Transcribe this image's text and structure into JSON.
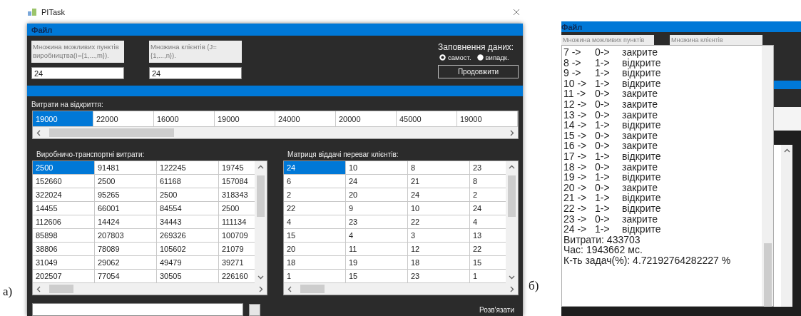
{
  "panel_a": {
    "caption": "а)",
    "title": "PITask",
    "menu": [
      "Файл"
    ],
    "fields": [
      {
        "label": "Множина можливих пунктів виробництва(I={1,...,m}).",
        "value": "24"
      },
      {
        "label": "Множина клієнтів (J={1,...,n}).",
        "value": "24"
      }
    ],
    "fill_options": {
      "title": "Заповнення даних:",
      "options": [
        {
          "label": "самост.",
          "selected": true
        },
        {
          "label": "випадк.",
          "selected": false
        }
      ]
    },
    "continue_button": "Продовжити",
    "opening_costs": {
      "title": "Витрати на відкриття:",
      "cells": [
        {
          "text": "19000",
          "selected": true
        },
        {
          "text": "22000",
          "selected": false
        },
        {
          "text": "16000",
          "selected": false
        },
        {
          "text": "19000",
          "selected": false
        },
        {
          "text": "24000",
          "selected": false
        },
        {
          "text": "20000",
          "selected": false
        },
        {
          "text": "45000",
          "selected": false
        },
        {
          "text": "19000",
          "selected": false
        }
      ]
    },
    "transport_costs": {
      "title": "Виробничо-транспортні витрати:",
      "rows": [
        [
          {
            "text": "2500",
            "selected": true
          },
          {
            "text": "91481",
            "selected": false
          },
          {
            "text": "122245",
            "selected": false
          },
          {
            "text": "19745",
            "selected": false
          }
        ],
        [
          {
            "text": "152660",
            "selected": false
          },
          {
            "text": "2500",
            "selected": false
          },
          {
            "text": "61168",
            "selected": false
          },
          {
            "text": "157084",
            "selected": false
          }
        ],
        [
          {
            "text": "322024",
            "selected": false
          },
          {
            "text": "95265",
            "selected": false
          },
          {
            "text": "2500",
            "selected": false
          },
          {
            "text": "318343",
            "selected": false
          }
        ],
        [
          {
            "text": "14455",
            "selected": false
          },
          {
            "text": "66001",
            "selected": false
          },
          {
            "text": "84554",
            "selected": false
          },
          {
            "text": "2500",
            "selected": false
          }
        ],
        [
          {
            "text": "112606",
            "selected": false
          },
          {
            "text": "14424",
            "selected": false
          },
          {
            "text": "34443",
            "selected": false
          },
          {
            "text": "111134",
            "selected": false
          }
        ],
        [
          {
            "text": "85898",
            "selected": false
          },
          {
            "text": "207803",
            "selected": false
          },
          {
            "text": "269326",
            "selected": false
          },
          {
            "text": "100709",
            "selected": false
          }
        ],
        [
          {
            "text": "38806",
            "selected": false
          },
          {
            "text": "78089",
            "selected": false
          },
          {
            "text": "105602",
            "selected": false
          },
          {
            "text": "21079",
            "selected": false
          }
        ],
        [
          {
            "text": "31049",
            "selected": false
          },
          {
            "text": "29062",
            "selected": false
          },
          {
            "text": "49479",
            "selected": false
          },
          {
            "text": "39271",
            "selected": false
          }
        ],
        [
          {
            "text": "202507",
            "selected": false
          },
          {
            "text": "77054",
            "selected": false
          },
          {
            "text": "30505",
            "selected": false
          },
          {
            "text": "226160",
            "selected": false
          }
        ]
      ]
    },
    "preferences": {
      "title": "Матриця віддачі переваг клієнтів:",
      "rows": [
        [
          {
            "text": "24",
            "selected": true
          },
          {
            "text": "10",
            "selected": false
          },
          {
            "text": "8",
            "selected": false
          },
          {
            "text": "23",
            "selected": false
          }
        ],
        [
          {
            "text": "6",
            "selected": false
          },
          {
            "text": "24",
            "selected": false
          },
          {
            "text": "21",
            "selected": false
          },
          {
            "text": "8",
            "selected": false
          }
        ],
        [
          {
            "text": "2",
            "selected": false
          },
          {
            "text": "20",
            "selected": false
          },
          {
            "text": "24",
            "selected": false
          },
          {
            "text": "2",
            "selected": false
          }
        ],
        [
          {
            "text": "22",
            "selected": false
          },
          {
            "text": "9",
            "selected": false
          },
          {
            "text": "10",
            "selected": false
          },
          {
            "text": "24",
            "selected": false
          }
        ],
        [
          {
            "text": "4",
            "selected": false
          },
          {
            "text": "23",
            "selected": false
          },
          {
            "text": "22",
            "selected": false
          },
          {
            "text": "4",
            "selected": false
          }
        ],
        [
          {
            "text": "15",
            "selected": false
          },
          {
            "text": "4",
            "selected": false
          },
          {
            "text": "3",
            "selected": false
          },
          {
            "text": "13",
            "selected": false
          }
        ],
        [
          {
            "text": "20",
            "selected": false
          },
          {
            "text": "11",
            "selected": false
          },
          {
            "text": "12",
            "selected": false
          },
          {
            "text": "22",
            "selected": false
          }
        ],
        [
          {
            "text": "18",
            "selected": false
          },
          {
            "text": "19",
            "selected": false
          },
          {
            "text": "18",
            "selected": false
          },
          {
            "text": "15",
            "selected": false
          }
        ],
        [
          {
            "text": "1",
            "selected": false
          },
          {
            "text": "15",
            "selected": false
          },
          {
            "text": "23",
            "selected": false
          },
          {
            "text": "1",
            "selected": false
          }
        ]
      ]
    },
    "solve_button": "Розв'язати"
  },
  "panel_b": {
    "caption": "б)",
    "menu": [
      "Файл"
    ],
    "field_labels": [
      "Множина можливих пунктів",
      "Множина клієнтів"
    ],
    "results": [
      {
        "point": "7 ->",
        "flag": "0->",
        "status": "закрите"
      },
      {
        "point": "8 ->",
        "flag": "1->",
        "status": "відкрите"
      },
      {
        "point": "9 ->",
        "flag": "1->",
        "status": "відкрите"
      },
      {
        "point": "10 ->",
        "flag": "1->",
        "status": "відкрите"
      },
      {
        "point": "11 ->",
        "flag": "0->",
        "status": "закрите"
      },
      {
        "point": "12 ->",
        "flag": "0->",
        "status": "закрите"
      },
      {
        "point": "13 ->",
        "flag": "0->",
        "status": "закрите"
      },
      {
        "point": "14 ->",
        "flag": "1->",
        "status": "відкрите"
      },
      {
        "point": "15 ->",
        "flag": "0->",
        "status": "закрите"
      },
      {
        "point": "16 ->",
        "flag": "0->",
        "status": "закрите"
      },
      {
        "point": "17 ->",
        "flag": "1->",
        "status": "відкрите"
      },
      {
        "point": "18 ->",
        "flag": "0->",
        "status": "закрите"
      },
      {
        "point": "19 ->",
        "flag": "1->",
        "status": "відкрите"
      },
      {
        "point": "20 ->",
        "flag": "0->",
        "status": "закрите"
      },
      {
        "point": "21 ->",
        "flag": "1->",
        "status": "відкрите"
      },
      {
        "point": "22 ->",
        "flag": "1->",
        "status": "відкрите"
      },
      {
        "point": "23 ->",
        "flag": "0->",
        "status": "закрите"
      },
      {
        "point": "24 ->",
        "flag": "1->",
        "status": "відкрите"
      }
    ],
    "summary": [
      "Витрати: 433703",
      "Час: 1943662 мс.",
      "К-ть задач(%): 4.72192764282227 %"
    ]
  }
}
